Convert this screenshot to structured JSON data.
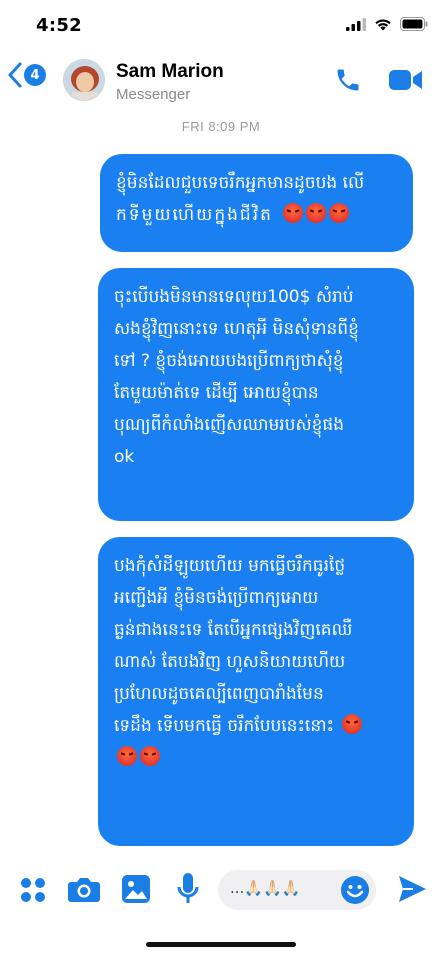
{
  "status": {
    "time": "4:52"
  },
  "header": {
    "back_count": "4",
    "contact_name": "Sam Marion",
    "contact_subtitle": "Messenger"
  },
  "thread": {
    "timestamp": "FRI 8:09 PM",
    "messages": [
      {
        "lines": [
          "ខ្ញុំមិនដែលជួបទេចរឹកអ្នកមានដូចបង លើ",
          "កទីមួយហើយក្នុងជីវិត"
        ],
        "emoji": [
          "angry-face",
          "angry-face",
          "angry-face"
        ]
      },
      {
        "lines": [
          "ចុះបើបងមិនមានទេលុយ100$ សំរាប់",
          "សងខ្ញុំវិញនោះទេ ហេតុអី មិនសុំទានពីខ្ញុំ",
          "ទៅ ? ខ្ញុំចង់អោយបងប្រើពាក្យថាសុំខ្ញុំ",
          "តែមួយម៉ាត់ទេ ដើម្បី អោយខ្ញុំបាន",
          "បុណ្យពីកំលាំងញើសឈាមរបស់ខ្ញុំផង",
          "ok"
        ]
      },
      {
        "lines": [
          "បងកុំសំដីឡូយហើយ មកធ្វើចរឹកធូរថ្លៃ",
          "អញ្ជើងអី ខ្ញុំមិនចង់ប្រើពាក្យអោយ",
          "ធ្ងន់ជាងនេះទេ តែបើអ្នកផ្សេងវិញគេឈឺ",
          "ណាស់ តែបងវិញ ហួសនិយាយហើយ",
          "ប្រហែលដូចគេល្បីពេញបារាំងមែន",
          "ទេដឹង ទើបមកធ្វើ ចរឹកបែបនេះនោះ"
        ],
        "emoji_inline": [
          "angry-face"
        ],
        "emoji_last": [
          "angry-face",
          "angry-face"
        ]
      }
    ]
  },
  "composer": {
    "text": "...🙏🏻🙏🏻🙏🏻",
    "icons": [
      "apps-icon",
      "camera-icon",
      "gallery-icon",
      "mic-icon",
      "emoji-icon",
      "send-icon"
    ]
  },
  "colors": {
    "accent": "#1a7ff0",
    "icon_blue": "#1a7ee5",
    "bubble_text": "#ffffff"
  }
}
